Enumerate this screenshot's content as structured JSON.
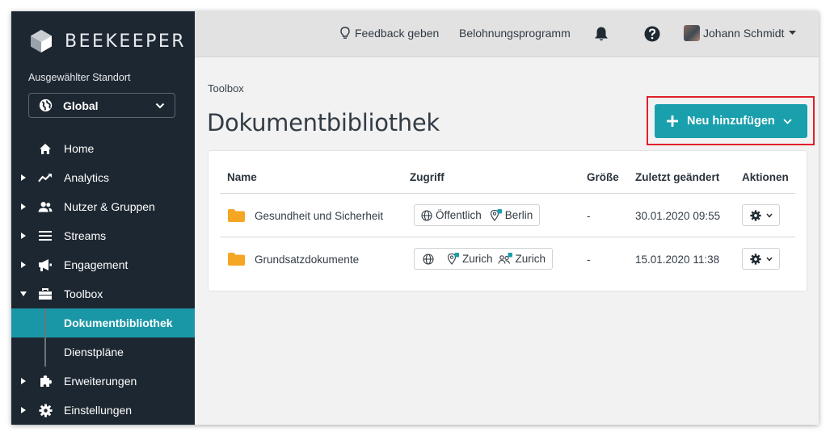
{
  "brand": {
    "name": "BEEKEEPER"
  },
  "sidebar": {
    "location_label": "Ausgewählter Standort",
    "location_value": "Global",
    "items": [
      {
        "label": "Home",
        "icon": "home-icon"
      },
      {
        "label": "Analytics",
        "icon": "analytics-icon"
      },
      {
        "label": "Nutzer & Gruppen",
        "icon": "users-icon"
      },
      {
        "label": "Streams",
        "icon": "streams-icon"
      },
      {
        "label": "Engagement",
        "icon": "megaphone-icon"
      },
      {
        "label": "Toolbox",
        "icon": "toolbox-icon"
      },
      {
        "label": "Erweiterungen",
        "icon": "puzzle-icon"
      },
      {
        "label": "Einstellungen",
        "icon": "gear-icon"
      }
    ],
    "subitems": [
      {
        "label": "Dokumentbibliothek",
        "active": true
      },
      {
        "label": "Dienstpläne",
        "active": false
      }
    ]
  },
  "topbar": {
    "feedback": "Feedback geben",
    "rewards": "Belohnungsprogramm",
    "user": "Johann Schmidt"
  },
  "main": {
    "breadcrumb": "Toolbox",
    "title": "Dokumentbibliothek",
    "add_button": "Neu hinzufügen"
  },
  "table": {
    "headers": {
      "name": "Name",
      "access": "Zugriff",
      "size": "Größe",
      "modified": "Zuletzt geändert",
      "actions": "Aktionen"
    },
    "rows": [
      {
        "name": "Gesundheit und Sicherheit",
        "access_public": "Öffentlich",
        "access_location": "Berlin",
        "access_group": "",
        "size": "-",
        "modified": "30.01.2020 09:55"
      },
      {
        "name": "Grundsatzdokumente",
        "access_public": "",
        "access_location": "Zurich",
        "access_group": "Zurich",
        "size": "-",
        "modified": "15.01.2020 11:38"
      }
    ]
  },
  "colors": {
    "sidebar": "#1d2731",
    "accent": "#1a9fad",
    "highlight": "#e0202a",
    "folder": "#f5a623"
  }
}
